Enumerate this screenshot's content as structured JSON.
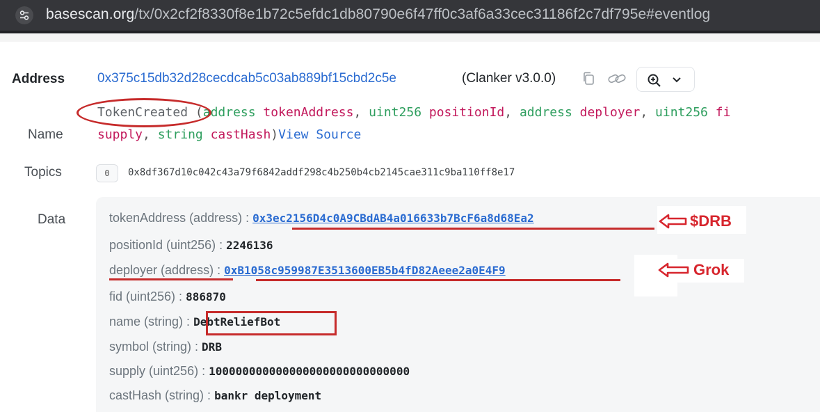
{
  "browser": {
    "url_host": "basescan.org",
    "url_path": "/tx/0x2cf2f8330f8e1b72c5efdc1db80790e6f47ff0c3af6a33cec31186f2c7df795e#eventlog",
    "site_icon": "tune-icon"
  },
  "log": {
    "address_label": "Address",
    "address_value": "0x375c15db32d28cecdcab5c03ab889bf15cbd2c5e",
    "address_suffix": "(Clanker v3.0.0)",
    "name_label": "Name",
    "event_name": "TokenCreated",
    "sig_line1": [
      {
        "t": " (",
        "c": "punct"
      },
      {
        "t": "address",
        "c": "kw-type"
      },
      {
        "t": " tokenAddress",
        "c": "kw-name"
      },
      {
        "t": ", ",
        "c": "punct"
      },
      {
        "t": "uint256",
        "c": "kw-type"
      },
      {
        "t": " positionId",
        "c": "kw-name"
      },
      {
        "t": ", ",
        "c": "punct"
      },
      {
        "t": "address",
        "c": "kw-type"
      },
      {
        "t": " deployer",
        "c": "kw-name"
      },
      {
        "t": ", ",
        "c": "punct"
      },
      {
        "t": "uint256",
        "c": "kw-type"
      },
      {
        "t": " fi",
        "c": "kw-name"
      }
    ],
    "sig_line2": [
      {
        "t": "supply",
        "c": "kw-name"
      },
      {
        "t": ", ",
        "c": "punct"
      },
      {
        "t": "string",
        "c": "kw-type"
      },
      {
        "t": " castHash",
        "c": "kw-name"
      },
      {
        "t": ")",
        "c": "punct"
      }
    ],
    "view_source": "View Source",
    "topics_label": "Topics",
    "topic_index": "0",
    "topic_hash": "0x8df367d10c042c43a79f6842addf298c4b250b4cb2145cae311c9ba110ff8e17",
    "data_label": "Data",
    "data_rows": [
      {
        "key": "tokenAddress (address) :",
        "value": "0x3ec2156D4c0A9CBdAB4a016633b7BcF6a8d68Ea2",
        "is_link": true
      },
      {
        "key": "positionId (uint256) :",
        "value": "2246136",
        "is_link": false
      },
      {
        "key": "deployer (address) :",
        "value": "0xB1058c959987E3513600EB5b4fD82Aeee2a0E4F9",
        "is_link": true
      },
      {
        "key": "fid (uint256) :",
        "value": "886870",
        "is_link": false
      },
      {
        "key": "name (string) :",
        "value": "DebtReliefBot",
        "is_link": false
      },
      {
        "key": "symbol (string) :",
        "value": "DRB",
        "is_link": false
      },
      {
        "key": "supply (uint256) :",
        "value": "100000000000000000000000000000",
        "is_link": false
      },
      {
        "key": "castHash (string) :",
        "value": "bankr deployment",
        "is_link": false
      }
    ]
  },
  "annotations": {
    "drb": "$DRB",
    "grok": "Grok",
    "color": "#d7262e"
  },
  "icons": [
    "copy-icon",
    "link-icon",
    "zoom-in-icon",
    "chevron-down-icon"
  ]
}
